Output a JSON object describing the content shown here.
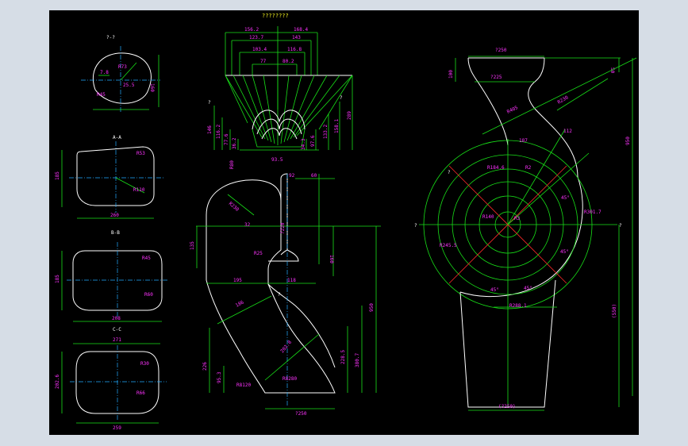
{
  "title": "????????",
  "sections": {
    "s1": "?-?",
    "s2": "A-A",
    "s3": "B-B",
    "s4": "C-C"
  },
  "view1": {
    "d1": "R73",
    "d2": "7.8",
    "d3": "25.5",
    "d4": "160",
    "d5": "R45"
  },
  "view2": {
    "d1": "R53",
    "d2": "R110",
    "d3": "185",
    "d4": "260"
  },
  "view3": {
    "d1": "R45",
    "d2": "R60",
    "d3": "185",
    "d4": "208"
  },
  "view4": {
    "d1": "271",
    "d2": "R30",
    "d3": "R66",
    "d4": "202.6",
    "d5": "259"
  },
  "fan": {
    "top": [
      "156.2",
      "168.4",
      "123.7",
      "143",
      "103.4",
      "116.8",
      "77",
      "80.2"
    ],
    "left": [
      "146",
      "116.2",
      "77.6",
      "36.2"
    ],
    "right": [
      "133.2",
      "158.1",
      "289",
      "97.6",
      "34.3"
    ],
    "bottom": [
      "93.5",
      "R80"
    ],
    "q": "?"
  },
  "duct": {
    "d1": "R230",
    "d2": "92",
    "d3": "60",
    "d4": "?220",
    "d5": "32",
    "d6": "135",
    "d7": "R25",
    "d8": "160",
    "d9": "195",
    "d10": "118",
    "d11": "186",
    "d12": "950",
    "d13": "226",
    "d14": "202.8",
    "d15": "228.5",
    "d16": "380.7",
    "d17": "95.3",
    "d18": "R8120",
    "d19": "R8280",
    "d20": "?250",
    "q": "?"
  },
  "volute": {
    "d1": "?250",
    "d2": "?225",
    "d3": "100",
    "d4": "50",
    "d5": "R230",
    "d6": "R405",
    "d7": "950",
    "d8": "R184.6",
    "d9": "R2",
    "d10": "R301.7",
    "d11": "R245.5",
    "d12": "R140",
    "d13": "R3",
    "d14": "45°",
    "d15": "R288.1",
    "d16": "(550)",
    "d17": "(?250)",
    "d18": "112",
    "d19": "187",
    "q": "?"
  }
}
